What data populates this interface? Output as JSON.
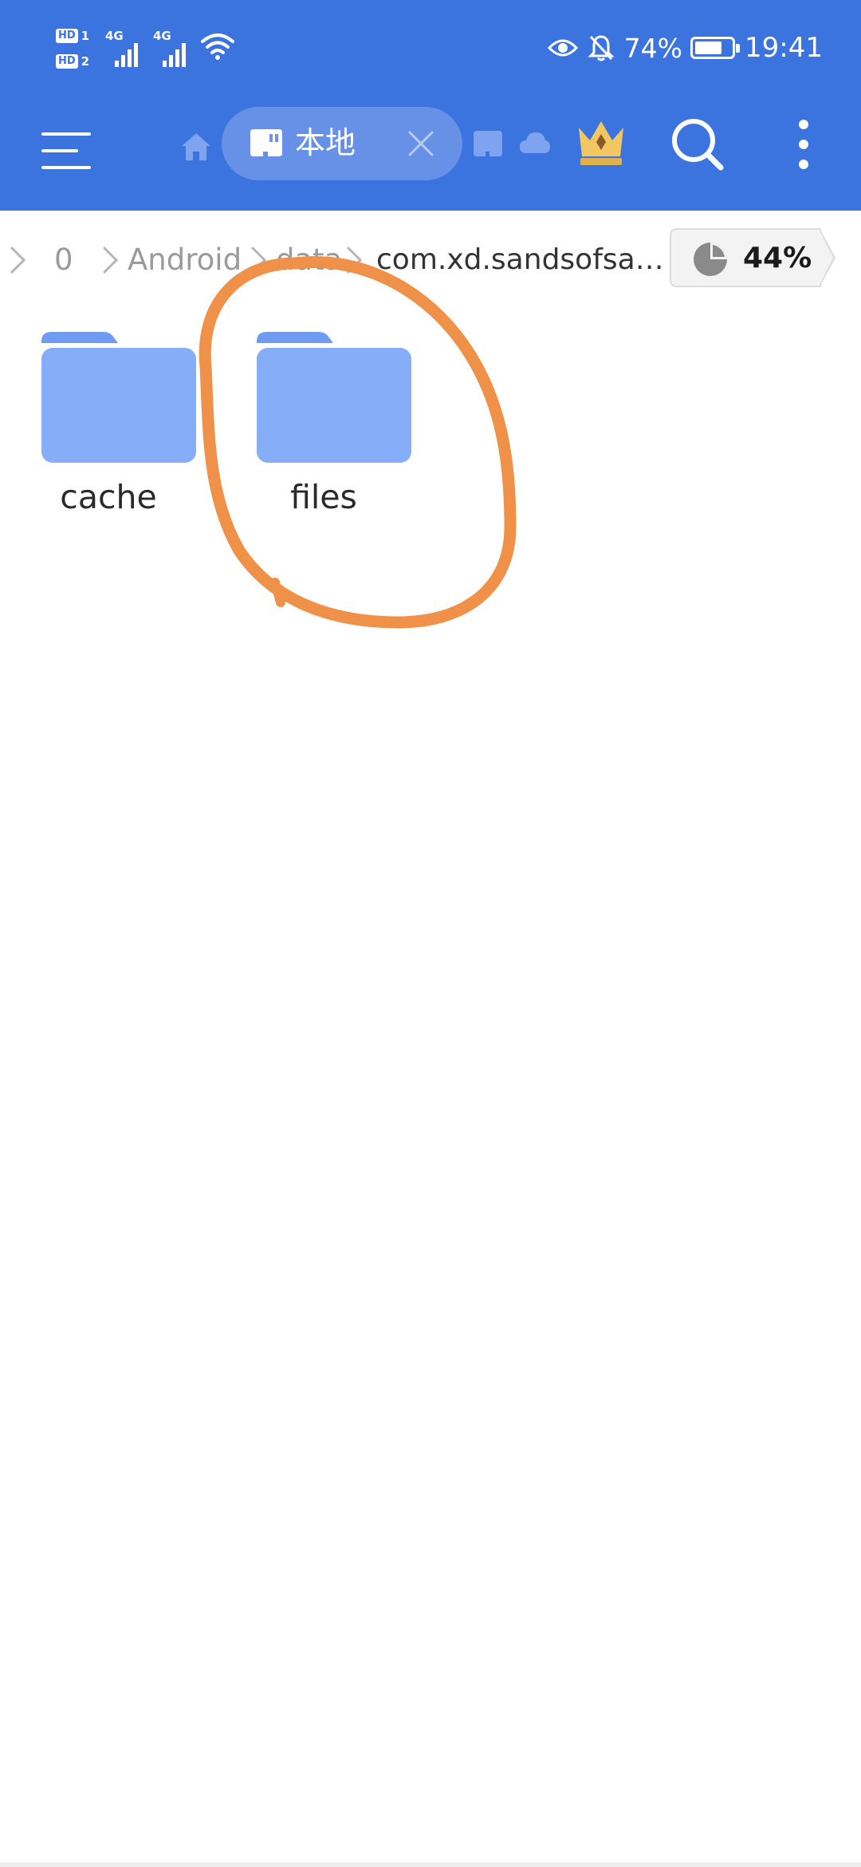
{
  "status_bar": {
    "sim1_badge": "HD",
    "sim1_num": "1",
    "sim2_badge": "HD",
    "sim2_num": "2",
    "net1": "4G",
    "net2": "4G",
    "battery_percent": "74%",
    "time": "19:41",
    "icons": [
      "eye-icon",
      "bell-muted-icon",
      "battery-icon",
      "wifi-icon",
      "signal-icon"
    ]
  },
  "toolbar": {
    "active_tab_label": "本地",
    "icons": [
      "menu-icon",
      "home-icon",
      "sd-card-icon",
      "close-icon",
      "cloud-icon",
      "crown-icon",
      "search-icon",
      "more-vertical-icon"
    ]
  },
  "breadcrumb": {
    "items": [
      "0",
      "Android",
      "data",
      "com.xd.sandsofsa…"
    ],
    "storage_used": "44%"
  },
  "folders": [
    {
      "name": "cache"
    },
    {
      "name": "files"
    }
  ],
  "colors": {
    "header": "#3b73df",
    "folder": "#86adf8",
    "folder_tab": "#6f9cf2",
    "annotation": "#f0914a",
    "crown_gold": "#f2c760"
  }
}
